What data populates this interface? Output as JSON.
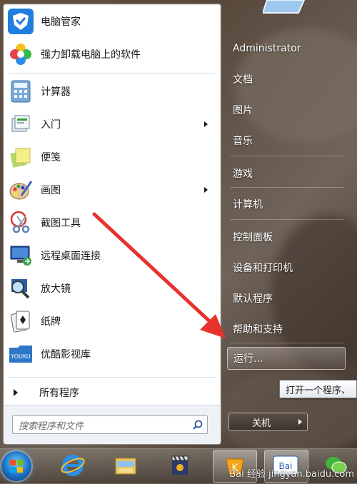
{
  "left_pane": {
    "pinned": [
      {
        "label": "电脑管家",
        "icon": "pc-manager-shield-icon"
      },
      {
        "label": "强力卸载电脑上的软件",
        "icon": "uninstall-flower-icon"
      }
    ],
    "recent": [
      {
        "label": "计算器",
        "icon": "calculator-icon",
        "has_submenu": false
      },
      {
        "label": "入门",
        "icon": "getting-started-icon",
        "has_submenu": true
      },
      {
        "label": "便笺",
        "icon": "sticky-notes-icon",
        "has_submenu": false
      },
      {
        "label": "画图",
        "icon": "paint-palette-icon",
        "has_submenu": true
      },
      {
        "label": "截图工具",
        "icon": "snipping-scissors-icon",
        "has_submenu": false
      },
      {
        "label": "远程桌面连接",
        "icon": "remote-desktop-icon",
        "has_submenu": false
      },
      {
        "label": "放大镜",
        "icon": "magnifier-icon",
        "has_submenu": false
      },
      {
        "label": "纸牌",
        "icon": "solitaire-cards-icon",
        "has_submenu": false
      },
      {
        "label": "优酷影视库",
        "icon": "youku-icon",
        "has_submenu": false
      }
    ],
    "all_programs_label": "所有程序",
    "search_placeholder": "搜索程序和文件"
  },
  "right_pane": {
    "user_name": "Administrator",
    "items": [
      "文档",
      "图片",
      "音乐",
      "游戏",
      "计算机",
      "控制面板",
      "设备和打印机",
      "默认程序",
      "帮助和支持",
      "运行..."
    ],
    "run_tooltip": "打开一个程序、",
    "shutdown_label": "关机"
  },
  "taskbar": {
    "icons": [
      "start-orb-icon",
      "internet-explorer-icon",
      "file-explorer-icon",
      "media-clapper-icon",
      "kingsoft-app-icon",
      "baidu-app-icon",
      "wechat-icon"
    ],
    "watermark": "Bai 经验 jingyan.baidu.com"
  },
  "colors": {
    "highlight_border": "#ffffff",
    "annotation_arrow": "#e8322c"
  }
}
